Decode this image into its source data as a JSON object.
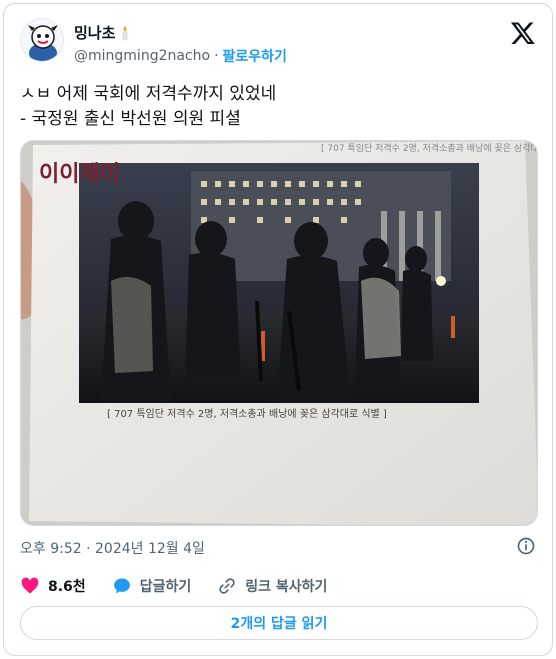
{
  "author": {
    "display_name": "밍나초",
    "handle": "@mingming2nacho",
    "separator": "·",
    "follow_label": "팔로우하기"
  },
  "tweet": {
    "text": "ㅅㅂ 어제 국회에 저격수까지 있었네\n- 국정원 출신 박선원 의원 피셜"
  },
  "media": {
    "watermark": "이이제이",
    "doc_header": "[ 707 특임단 저격수 2명, 저격소총과 배낭에 꽂은 삼각대로 식별 ]",
    "caption": "[ 707 특임단 저격수 2명, 저격소총과 배낭에 꽂은 삼각대로 식별 ]"
  },
  "timestamp": "오후 9:52 · 2024년 12월 4일",
  "actions": {
    "like_count": "8.6천",
    "reply_label": "답글하기",
    "copy_link_label": "링크 복사하기"
  },
  "read_replies_label": "2개의 답글 읽기",
  "colors": {
    "accent": "#1d9bf0",
    "like": "#f91880",
    "text_primary": "#0f1419",
    "text_secondary": "#536471",
    "border": "#cfd9de"
  },
  "icons": {
    "avatar": "cartoon-avatar",
    "name_emoji": "candle-icon",
    "brand": "x-logo-icon",
    "info": "info-icon",
    "like": "heart-icon",
    "reply": "speech-bubble-icon",
    "copy_link": "link-icon"
  }
}
